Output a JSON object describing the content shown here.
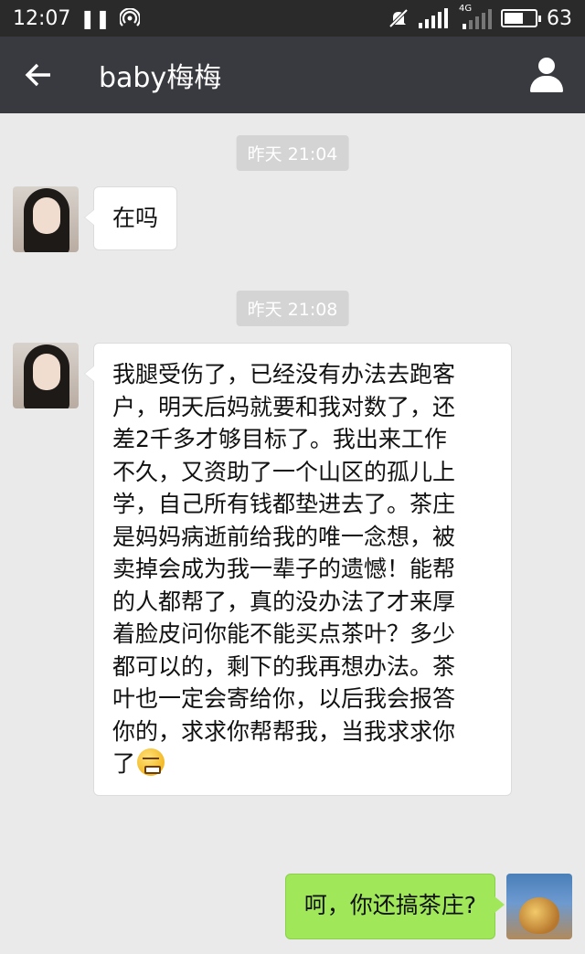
{
  "status_bar": {
    "time": "12:07",
    "battery": "63",
    "battery_level": 0.63,
    "network_label": "4G"
  },
  "header": {
    "title": "baby梅梅",
    "back_icon": "arrow-left-icon",
    "profile_icon": "person-icon"
  },
  "messages": [
    {
      "type": "timestamp",
      "text": "昨天 21:04"
    },
    {
      "type": "incoming",
      "text": "在吗"
    },
    {
      "type": "timestamp",
      "text": "昨天 21:08"
    },
    {
      "type": "incoming",
      "lines": [
        "我腿受伤了，已经没有办法去跑客",
        "户，明天后妈就要和我对数了，还",
        "差2千多才够目标了。我出来工作",
        "不久，又资助了一个山区的孤儿上",
        "学，自己所有钱都垫进去了。茶庄",
        "是妈妈病逝前给我的唯一念想，被",
        "卖掉会成为我一辈子的遗憾！能帮",
        "的人都帮了，真的没办法了才来厚",
        "着脸皮问你能不能买点茶叶？多少",
        "都可以的，剩下的我再想办法。茶",
        "叶也一定会寄给你，以后我会报答",
        "你的，求求你帮帮我，当我求求你",
        "了"
      ],
      "emoji": "grimace-emoji"
    },
    {
      "type": "outgoing",
      "text": "呵，你还搞茶庄?"
    }
  ],
  "colors": {
    "status_bar": "#2a2a2a",
    "title_bar": "#393a3f",
    "chat_bg": "#eaeaea",
    "outgoing_bubble": "#a0e75a",
    "incoming_bubble": "#ffffff"
  }
}
